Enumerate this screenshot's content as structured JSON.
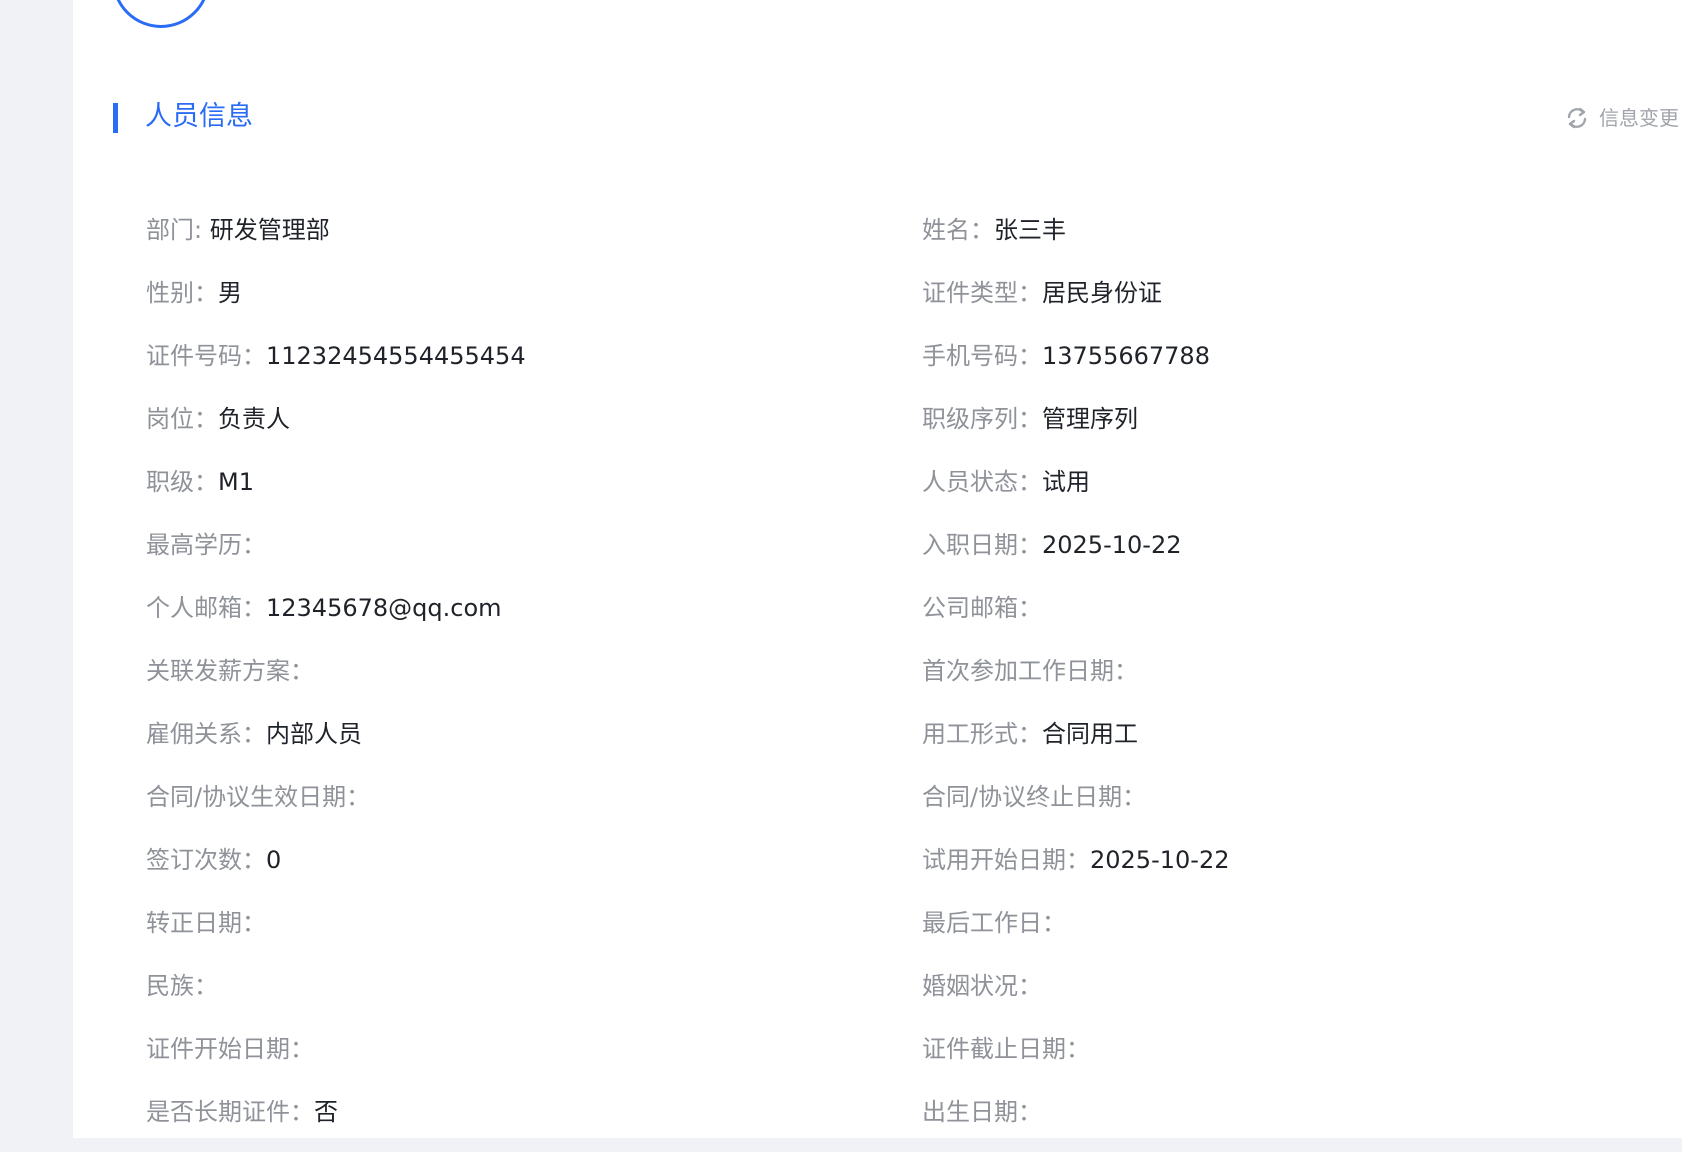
{
  "section": {
    "title": "人员信息",
    "action_label": "信息变更",
    "action_icon": "refresh-icon",
    "accent_color": "#2b6cf6"
  },
  "rows": [
    {
      "left": {
        "label": "部门: ",
        "value": "研发管理部"
      },
      "right": {
        "label": "姓名：",
        "value": "张三丰"
      }
    },
    {
      "left": {
        "label": "性别：",
        "value": "男"
      },
      "right": {
        "label": "证件类型：",
        "value": "居民身份证"
      }
    },
    {
      "left": {
        "label": "证件号码：",
        "value": "11232454554455454"
      },
      "right": {
        "label": "手机号码：",
        "value": "13755667788"
      }
    },
    {
      "left": {
        "label": "岗位：",
        "value": "负责人"
      },
      "right": {
        "label": "职级序列：",
        "value": "管理序列"
      }
    },
    {
      "left": {
        "label": "职级：",
        "value": "M1"
      },
      "right": {
        "label": "人员状态：",
        "value": "试用"
      }
    },
    {
      "left": {
        "label": "最高学历：",
        "value": ""
      },
      "right": {
        "label": "入职日期：",
        "value": "2025-10-22"
      }
    },
    {
      "left": {
        "label": "个人邮箱：",
        "value": "12345678@qq.com"
      },
      "right": {
        "label": "公司邮箱：",
        "value": ""
      }
    },
    {
      "left": {
        "label": "关联发薪方案：",
        "value": ""
      },
      "right": {
        "label": "首次参加工作日期：",
        "value": ""
      }
    },
    {
      "left": {
        "label": "雇佣关系：",
        "value": "内部人员"
      },
      "right": {
        "label": "用工形式：",
        "value": "合同用工"
      }
    },
    {
      "left": {
        "label": "合同/协议生效日期：",
        "value": ""
      },
      "right": {
        "label": "合同/协议终止日期：",
        "value": ""
      }
    },
    {
      "left": {
        "label": "签订次数：",
        "value": "0"
      },
      "right": {
        "label": "试用开始日期：",
        "value": "2025-10-22"
      }
    },
    {
      "left": {
        "label": "转正日期：",
        "value": ""
      },
      "right": {
        "label": "最后工作日：",
        "value": ""
      }
    },
    {
      "left": {
        "label": "民族：",
        "value": ""
      },
      "right": {
        "label": "婚姻状况：",
        "value": ""
      }
    },
    {
      "left": {
        "label": "证件开始日期：",
        "value": ""
      },
      "right": {
        "label": "证件截止日期：",
        "value": ""
      }
    },
    {
      "left": {
        "label": "是否长期证件：",
        "value": "否"
      },
      "right": {
        "label": "出生日期：",
        "value": ""
      }
    }
  ]
}
